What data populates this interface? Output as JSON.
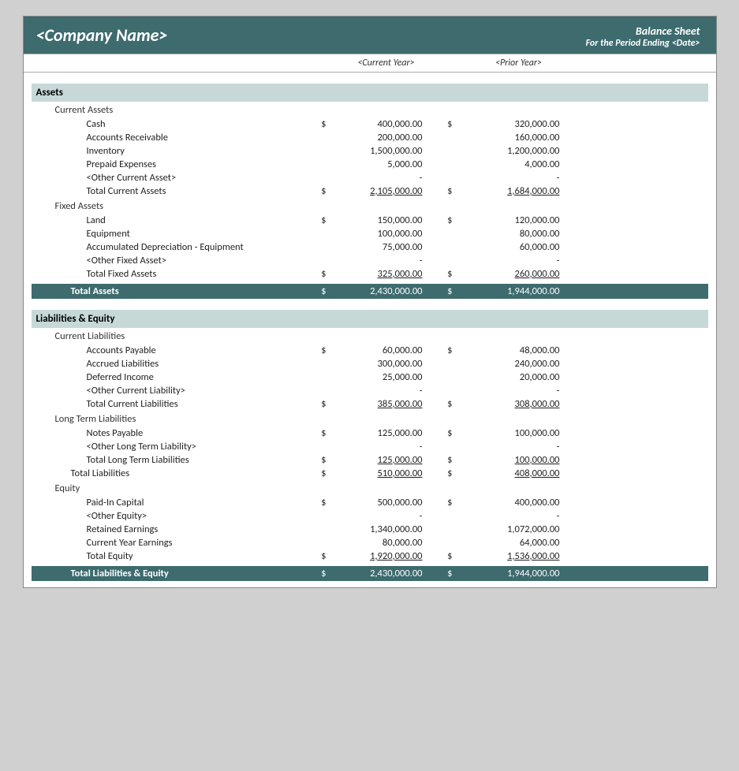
{
  "header": {
    "company": "<Company Name>",
    "title": "Balance Sheet",
    "subtitle": "For the Period Ending <Date>",
    "col_cy": "<Current Year>",
    "col_py": "<Prior Year>"
  },
  "sections": {
    "assets_header": "Assets",
    "current_assets_label": "Current Assets",
    "fixed_assets_label": "Fixed Assets",
    "liabilities_equity_header": "Liabilities & Equity",
    "current_liabilities_label": "Current Liabilities",
    "long_term_liabilities_label": "Long Term Liabilities",
    "equity_label": "Equity"
  },
  "rows": {
    "cash_label": "Cash",
    "cash_cy": "400,000.00",
    "cash_py": "320,000.00",
    "ar_label": "Accounts Receivable",
    "ar_cy": "200,000.00",
    "ar_py": "160,000.00",
    "inv_label": "Inventory",
    "inv_cy": "1,500,000.00",
    "inv_py": "1,200,000.00",
    "prepaid_label": "Prepaid Expenses",
    "prepaid_cy": "5,000.00",
    "prepaid_py": "4,000.00",
    "other_ca_label": "<Other Current Asset>",
    "other_ca_cy": "-",
    "other_ca_py": "-",
    "total_ca_label": "Total Current Assets",
    "total_ca_cy": "2,105,000.00",
    "total_ca_py": "1,684,000.00",
    "land_label": "Land",
    "land_cy": "150,000.00",
    "land_py": "120,000.00",
    "equip_label": "Equipment",
    "equip_cy": "100,000.00",
    "equip_py": "80,000.00",
    "acc_dep_label": "Accumulated Depreciation - Equipment",
    "acc_dep_cy": "75,000.00",
    "acc_dep_py": "60,000.00",
    "other_fa_label": "<Other Fixed Asset>",
    "other_fa_cy": "-",
    "other_fa_py": "-",
    "total_fa_label": "Total Fixed Assets",
    "total_fa_cy": "325,000.00",
    "total_fa_py": "260,000.00",
    "total_assets_label": "Total Assets",
    "total_assets_cy": "2,430,000.00",
    "total_assets_py": "1,944,000.00",
    "ap_label": "Accounts Payable",
    "ap_cy": "60,000.00",
    "ap_py": "48,000.00",
    "accrued_label": "Accrued Liabilities",
    "accrued_cy": "300,000.00",
    "accrued_py": "240,000.00",
    "deferred_label": "Deferred Income",
    "deferred_cy": "25,000.00",
    "deferred_py": "20,000.00",
    "other_cl_label": "<Other Current Liability>",
    "other_cl_cy": "-",
    "other_cl_py": "-",
    "total_cl_label": "Total Current Liabilities",
    "total_cl_cy": "385,000.00",
    "total_cl_py": "308,000.00",
    "notes_pay_label": "Notes Payable",
    "notes_pay_cy": "125,000.00",
    "notes_pay_py": "100,000.00",
    "other_ltl_label": "<Other Long Term Liability>",
    "other_ltl_cy": "-",
    "other_ltl_py": "-",
    "total_ltl_label": "Total Long Term Liabilities",
    "total_ltl_cy": "125,000.00",
    "total_ltl_py": "100,000.00",
    "total_liab_label": "Total Liabilities",
    "total_liab_cy": "510,000.00",
    "total_liab_py": "408,000.00",
    "paid_in_label": "Paid-In Capital",
    "paid_in_cy": "500,000.00",
    "paid_in_py": "400,000.00",
    "other_eq_label": "<Other Equity>",
    "other_eq_cy": "-",
    "other_eq_py": "-",
    "retained_label": "Retained Earnings",
    "retained_cy": "1,340,000.00",
    "retained_py": "1,072,000.00",
    "cy_earnings_label": "Current Year Earnings",
    "cy_earnings_cy": "80,000.00",
    "cy_earnings_py": "64,000.00",
    "total_eq_label": "Total Equity",
    "total_eq_cy": "1,920,000.00",
    "total_eq_py": "1,536,000.00",
    "total_le_label": "Total Liabilities & Equity",
    "total_le_cy": "2,430,000.00",
    "total_le_py": "1,944,000.00"
  }
}
